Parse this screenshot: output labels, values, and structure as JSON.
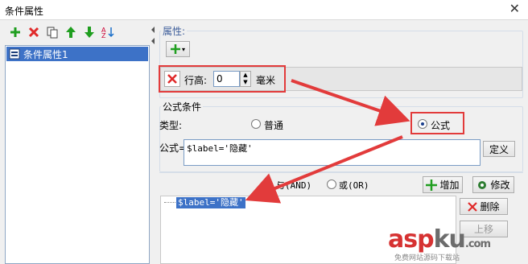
{
  "window": {
    "title": "条件属性",
    "close": "✕"
  },
  "left": {
    "items": [
      {
        "label": "条件属性1"
      }
    ]
  },
  "properties": {
    "group_label": "属性:",
    "row_height_label": "行高:",
    "row_height_value": "0",
    "unit": "毫米"
  },
  "formula_condition": {
    "group_label": "公式条件",
    "type_label": "类型:",
    "type_normal": "普通",
    "type_formula": "公式",
    "formula_label": "公式=",
    "formula_value": "$label='隐藏'",
    "define_button": "定义"
  },
  "logic": {
    "and_label": "与(AND)",
    "or_label": "或(OR)",
    "add_button": "增加",
    "modify_button": "修改",
    "delete_button": "删除",
    "up_button": "上移",
    "list_items": [
      {
        "text": "$label='隐藏'"
      }
    ]
  },
  "watermark": {
    "brand": "asp",
    "brand2": "ku",
    "sub": "免费网站源码下载站",
    "domain": ".com"
  },
  "colors": {
    "accent": "#3d72c7",
    "annotation": "#e23b3b",
    "add": "#1f9e1f",
    "delete": "#e02a2a"
  }
}
